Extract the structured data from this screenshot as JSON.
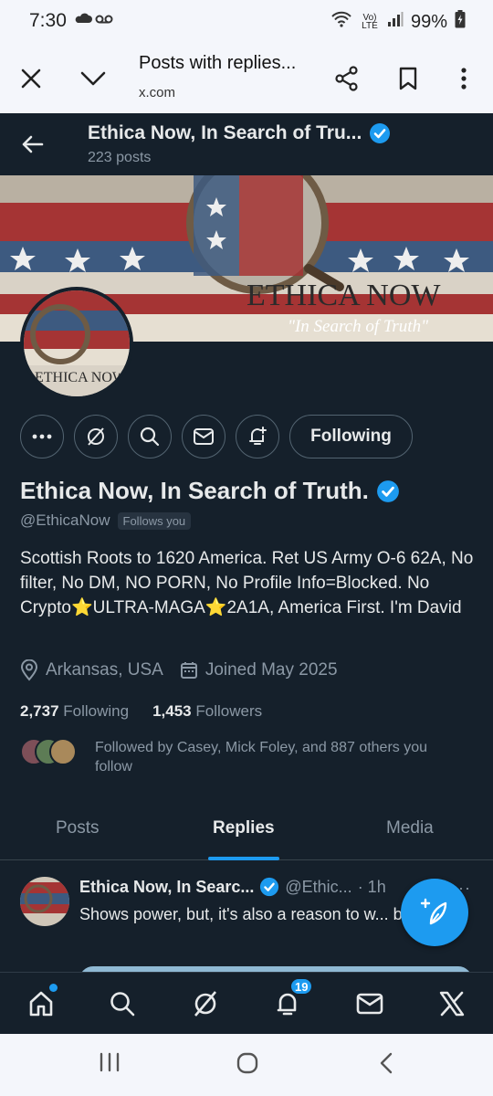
{
  "status_bar": {
    "time": "7:30",
    "network": "Vo) LTE",
    "battery": "99%"
  },
  "browser": {
    "title": "Posts with replies...",
    "url": "x.com"
  },
  "profile_header": {
    "name": "Ethica Now, In Search of Tru...",
    "post_count": "223 posts"
  },
  "banner": {
    "title": "ETHICA NOW",
    "tagline": "\"In Search of Truth\""
  },
  "actions": {
    "following_label": "Following"
  },
  "profile": {
    "name": "Ethica Now, In Search of Truth.",
    "handle": "@EthicaNow",
    "follows_you": "Follows you",
    "bio_1": "Scottish Roots to 1620 America. Ret US Army O-6 62A, No filter, No DM, NO PORN, No Profile Info=Blocked.  No Crypto",
    "bio_2": "ULTRA-MAGA",
    "bio_3": "2A1A, America First. I'm David",
    "location": "Arkansas, USA",
    "joined": "Joined May 2025",
    "following_count": "2,737",
    "following_label": "Following",
    "followers_count": "1,453",
    "followers_label": "Followers",
    "followed_by": "Followed by Casey, Mick Foley, and 887 others you follow"
  },
  "tabs": [
    {
      "label": "Posts"
    },
    {
      "label": "Replies"
    },
    {
      "label": "Media"
    }
  ],
  "post": {
    "name": "Ethica Now, In Searc...",
    "handle": "@Ethic...",
    "time": "· 1h",
    "text": "Shows power, but, it's also a reason to w... bit."
  },
  "bottom_nav": {
    "notification_count": "19"
  },
  "colors": {
    "background": "#15202b",
    "accent": "#1d9bf0",
    "muted_text": "#8b98a5"
  }
}
